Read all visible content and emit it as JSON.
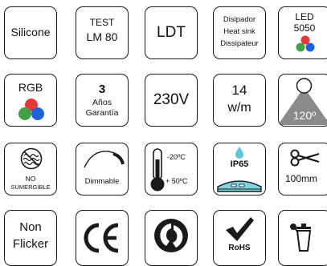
{
  "row1": {
    "silicone": "Silicone",
    "test_line1": "TEST",
    "test_line2": "LM 80",
    "ldt": "LDT",
    "disipador_line1": "Disipador",
    "disipador_line2": "Heat sink",
    "disipador_line3": "Dissipateur",
    "led_line1": "LED",
    "led_line2": "5050"
  },
  "row2": {
    "rgb": "RGB",
    "warranty_years": "3",
    "warranty_line2": "Años",
    "warranty_line3": "Garantía",
    "voltage": "230V",
    "power_value": "14",
    "power_unit": "w/m",
    "beam_angle": "120º"
  },
  "row3": {
    "not_submersible_line1": "NO",
    "not_submersible_line2": "SUMERGIBLE",
    "dimmable": "Dimmable",
    "temp_max": "-20ºC",
    "temp_min": "+ 50ºC",
    "ip_rating": "IP65",
    "cut_length": "100mm"
  },
  "row4": {
    "non_flicker_line1": "Non",
    "non_flicker_line2": "Flicker",
    "ce_mark": "CE",
    "rohs": "RoHS"
  },
  "colors": {
    "rgb_red": "#e53935",
    "rgb_green": "#43a047",
    "rgb_blue": "#1e63d6",
    "beam_gray": "#8a8a8a",
    "ip_cyan": "#7fd3e0",
    "ip_drop": "#5fc6d8"
  }
}
